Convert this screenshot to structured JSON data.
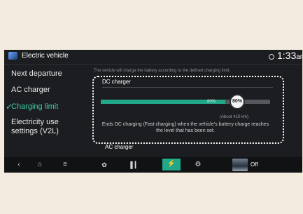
{
  "header": {
    "title": "Electric vehicle",
    "clock": "1:33",
    "ampm": "am"
  },
  "sidebar": {
    "items": [
      {
        "label": "Next departure"
      },
      {
        "label": "AC charger"
      },
      {
        "label": "Charging limit",
        "active": true
      },
      {
        "label": "Electricity use settings (V2L)",
        "line1": "Electricity use",
        "line2": "settings (V2L)"
      }
    ]
  },
  "main": {
    "description": "The vehicle will charge the battery according to the defined charging limit.",
    "dc": {
      "label": "DC charger",
      "limit_percent": 80,
      "fill_label": "80%",
      "knob_label": "80%",
      "range": "(About 410 km)",
      "note": "Ends DC charging (Fast charging) when the vehicle's battery charge reaches the level that has been set."
    },
    "ac_label": "AC charger"
  },
  "bottombar": {
    "back_icon": "back-chevron-icon",
    "home_icon": "home-icon",
    "menu_icon": "menu-icon",
    "fan_icon": "fan-icon",
    "equalizer_icon": "equalizer-icon",
    "ev_icon": "ev-charging-icon",
    "settings_icon": "gear-icon",
    "media_status": "Off"
  },
  "colors": {
    "accent": "#20a888",
    "active_text": "#3fd0a6",
    "background": "#1c1d20"
  }
}
